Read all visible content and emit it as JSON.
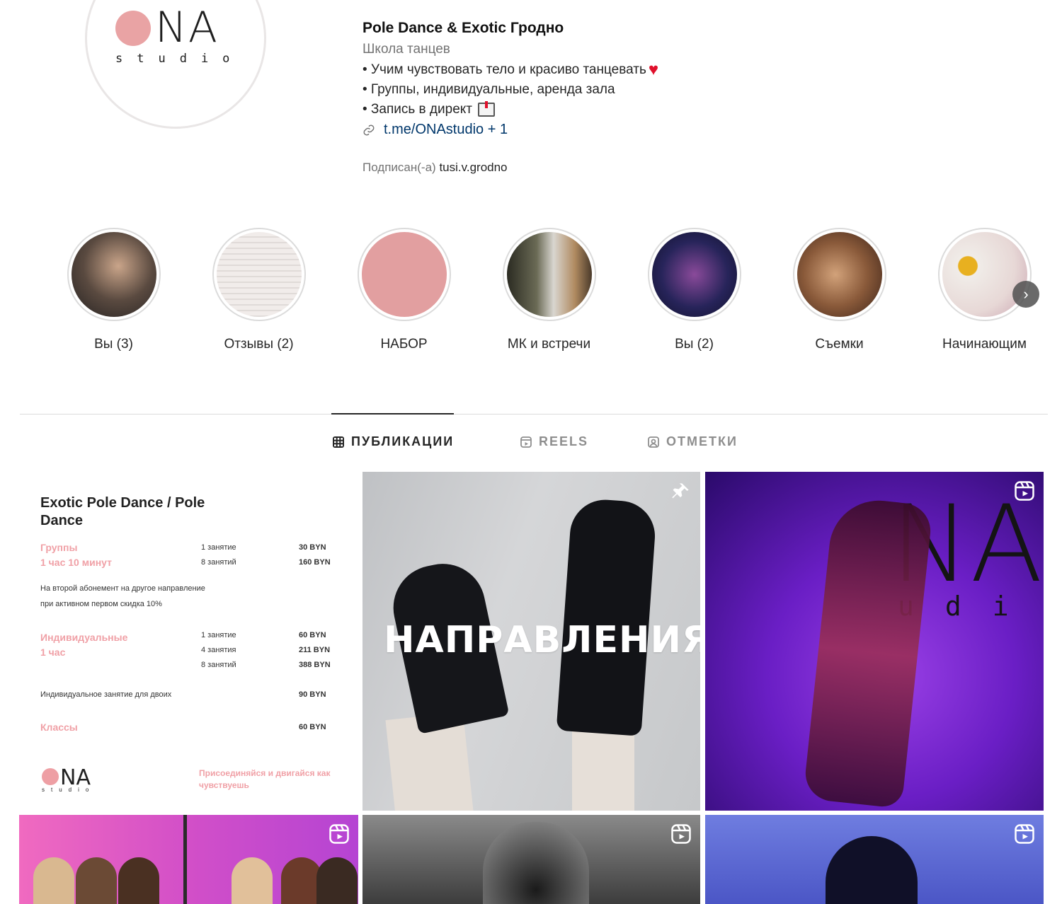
{
  "profile": {
    "logo_main": "NA",
    "logo_sub": "studio",
    "name": "Pole Dance & Exotic Гродно",
    "category": "Школа танцев",
    "bio_lines": [
      "• Учим чувствовать тело и красиво танцевать",
      "• Группы, индивидуальные, аренда зала",
      "• Запись в директ"
    ],
    "link": "t.me/ONAstudio + 1",
    "followed_prefix": "Подписан(-а)",
    "followed_user": "tusi.v.grodno"
  },
  "highlights": [
    {
      "label": "Вы (3)",
      "color": "#5a4a40"
    },
    {
      "label": "Отзывы (2)",
      "color": "#e8e2df"
    },
    {
      "label": "НАБОР",
      "color": "#e29fa0"
    },
    {
      "label": "МК и встречи",
      "color": "#7a6a55"
    },
    {
      "label": "Вы (2)",
      "color": "#27245a"
    },
    {
      "label": "Съемки",
      "color": "#8a5a3a"
    },
    {
      "label": "Начинающим",
      "color": "#e7d8d6"
    }
  ],
  "tabs": [
    {
      "label": "ПУБЛИКАЦИИ",
      "icon": "grid-icon",
      "active": true
    },
    {
      "label": "REELS",
      "icon": "reels-icon",
      "active": false
    },
    {
      "label": "ОТМЕТКИ",
      "icon": "tagged-icon",
      "active": false
    }
  ],
  "price_card": {
    "title": "Exotic Pole Dance / Pole Dance",
    "groups_label": "Группы",
    "groups_duration": "1 час 10 минут",
    "groups": [
      {
        "qty": "1 занятие",
        "price": "30 BYN"
      },
      {
        "qty": "8 занятий",
        "price": "160 BYN"
      }
    ],
    "note_line1": "На второй абонемент на другое направление",
    "note_line2": "при активном первом скидка 10%",
    "individual_label": "Индивидуальные",
    "individual_duration": "1 час",
    "individual": [
      {
        "qty": "1 занятие",
        "price": "60 BYN"
      },
      {
        "qty": "4 занятия",
        "price": "211 BYN"
      },
      {
        "qty": "8 занятий",
        "price": "388 BYN"
      }
    ],
    "pair_label": "Индивидуальное занятие для двоих",
    "pair_price": "90 BYN",
    "classes_label": "Классы",
    "classes_price": "60 BYN",
    "logo_main": "NA",
    "logo_sub": "studio",
    "slogan": "Присоединяйся и двигайся как чувствуешь"
  },
  "posts": {
    "pinned_text": "НАПРАВЛЕНИЯ",
    "reel_logo_main": "NA",
    "reel_logo_sub": "udi"
  }
}
